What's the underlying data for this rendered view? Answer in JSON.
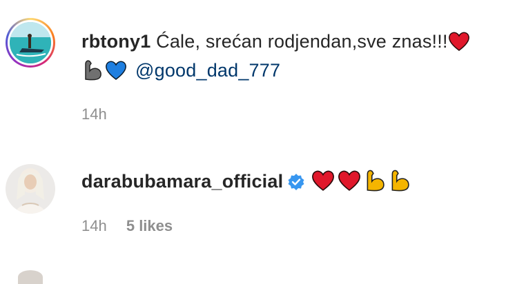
{
  "comments": [
    {
      "username": "rbtony1",
      "text": "Ćale, srećan rodjendan,sve znas!!!",
      "emojis": [
        "red-heart",
        "flexed-biceps-gray",
        "blue-heart"
      ],
      "mention": "@good_dad_777",
      "time": "14h",
      "likes": ""
    },
    {
      "username": "darabubamara_official",
      "verified": true,
      "emojis": [
        "red-heart",
        "red-heart",
        "flexed-biceps",
        "flexed-biceps"
      ],
      "time": "14h",
      "likes": "5 likes"
    }
  ],
  "colors": {
    "text": "#262626",
    "mention": "#00376b",
    "meta": "#8e8e8e",
    "verified": "#3897f0",
    "heart_red": "#e0182b",
    "heart_blue": "#1f7fe0",
    "biceps_yellow": "#f5b500",
    "biceps_gray": "#707070"
  }
}
